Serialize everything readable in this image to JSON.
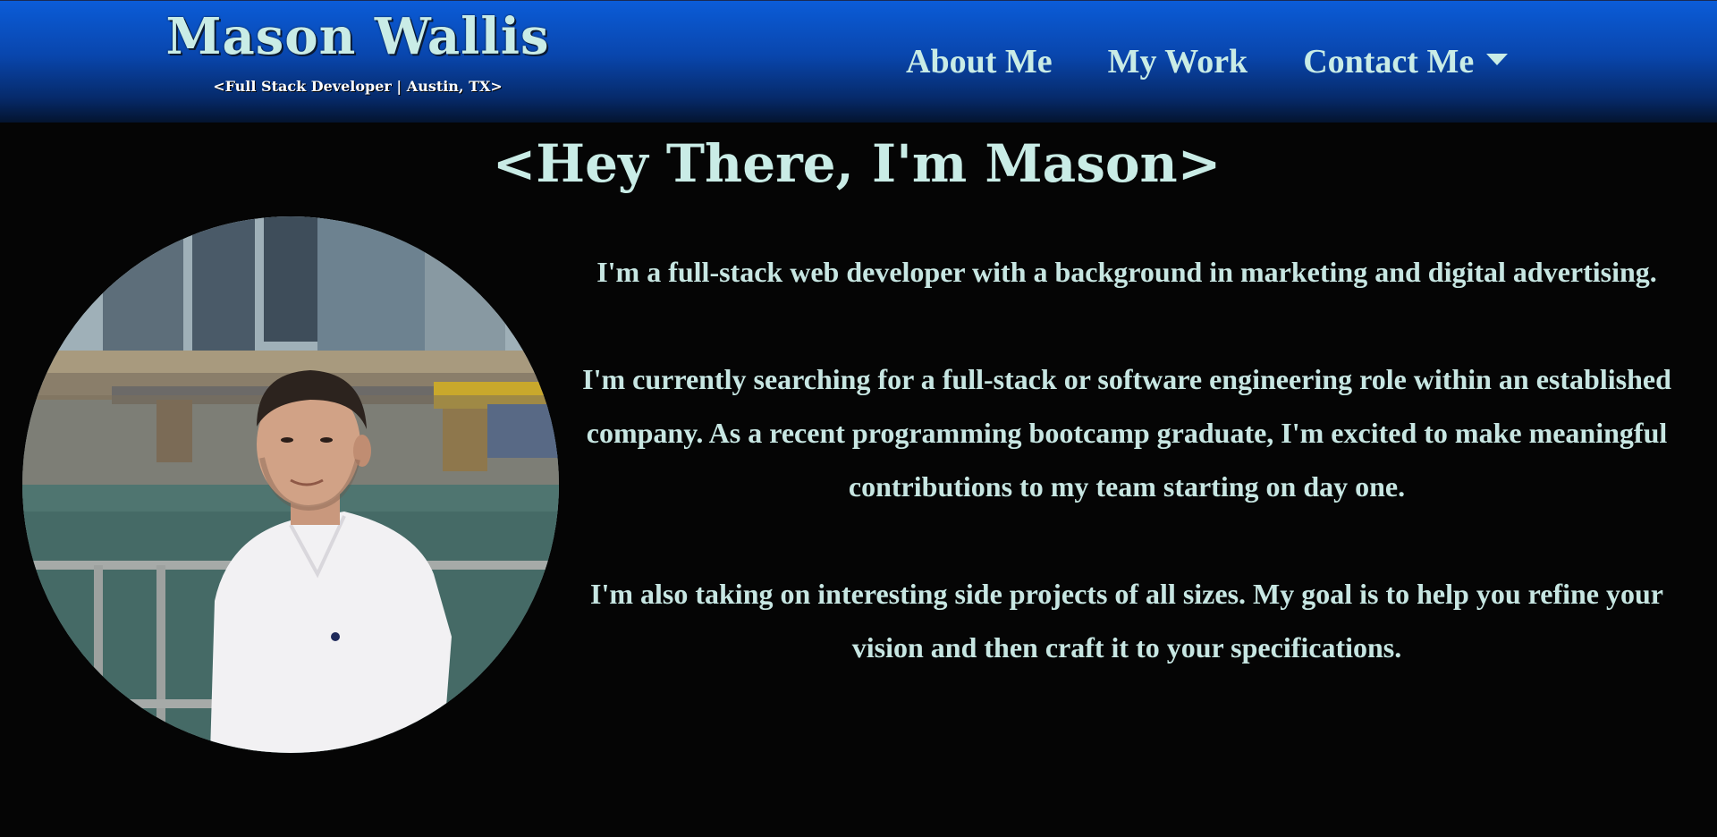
{
  "header": {
    "name": "Mason Wallis",
    "tagline": "<Full Stack Developer | Austin, TX>",
    "nav": [
      {
        "label": "About Me"
      },
      {
        "label": "My Work"
      },
      {
        "label": "Contact Me",
        "has_dropdown": true
      }
    ]
  },
  "main": {
    "title": "<Hey There, I'm Mason>",
    "paragraphs": [
      "I'm a full-stack web developer with a background in marketing and digital advertising.",
      "I'm currently searching for a full-stack or software engineering role within an established company. As a recent programming bootcamp graduate, I'm excited to make meaningful contributions to my team starting on day one.",
      "I'm also taking on interesting side projects of all sizes. My goal is to help you refine your vision and then craft it to your specifications."
    ]
  },
  "colors": {
    "header_gradient_top": "#0b5cd8",
    "header_gradient_bottom": "#04142f",
    "text_mint": "#c9ece6",
    "background": "#050505"
  },
  "icons": {
    "dropdown": "caret-down-icon"
  }
}
